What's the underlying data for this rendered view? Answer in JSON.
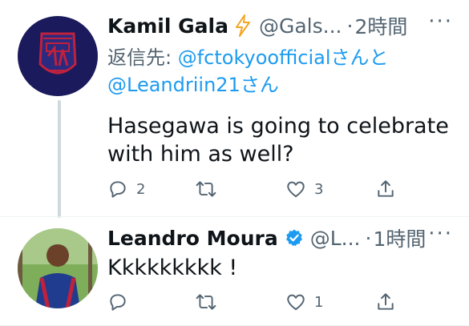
{
  "tweets": [
    {
      "name": "Kamil Gala",
      "handle": "@Gals...",
      "separator": "·",
      "time": "2時間",
      "more": "···",
      "reply_prefix": "返信先: ",
      "reply_mention_1": "@fctokyoofficial",
      "reply_suffix_1": "さんと",
      "reply_mention_2": "@Leandriin21",
      "reply_suffix_2": "さん",
      "text": "Hasegawa is going to celebrate with him as well?",
      "replies": "2",
      "retweets": "",
      "likes": "3"
    },
    {
      "name": "Leandro Moura",
      "handle": "@L...",
      "separator": "·",
      "time": "1時間",
      "more": "···",
      "text": "Kkkkkkkkk !",
      "replies": "",
      "retweets": "",
      "likes": "1"
    }
  ],
  "colors": {
    "link": "#1d9bf0",
    "muted": "#536471",
    "text": "#0f1419",
    "verified": "#1d9bf0",
    "lightning": "#f5a623"
  },
  "icons": {
    "reply": "reply-icon",
    "retweet": "retweet-icon",
    "like": "heart-icon",
    "share": "share-icon",
    "verified": "verified-badge-icon",
    "lightning": "lightning-icon"
  }
}
